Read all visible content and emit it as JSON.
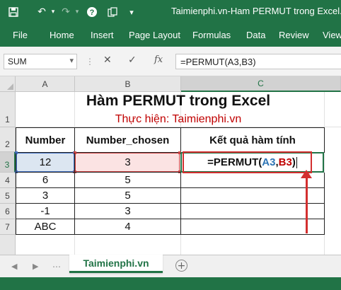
{
  "title_bar": {
    "title": "Taimienphi.vn-Ham PERMUT trong Excel.xls",
    "icons": [
      "save-icon",
      "undo-icon",
      "undo-dropdown-icon",
      "redo-icon",
      "redo-dropdown-icon",
      "help-icon",
      "copy-icon",
      "customize-dropdown-icon"
    ]
  },
  "ribbon_tabs": [
    "File",
    "Home",
    "Insert",
    "Page Layout",
    "Formulas",
    "Data",
    "Review",
    "View"
  ],
  "formula_bar": {
    "name_box": "SUM",
    "cancel_icon": "✕",
    "enter_icon": "✓",
    "fx_label": "fx",
    "formula": "=PERMUT(A3,B3)"
  },
  "grid": {
    "columns": [
      "A",
      "B",
      "C"
    ],
    "rows": [
      "1",
      "2",
      "3",
      "4",
      "5",
      "6",
      "7"
    ],
    "selected_column": "C",
    "selected_row": "3"
  },
  "sheet": {
    "title": "Hàm PERMUT trong Excel",
    "subtitle": "Thực hiện: Taimienphi.vn",
    "headers": [
      "Number",
      "Number_chosen",
      "Kết quả hàm tính"
    ],
    "data_rows": [
      {
        "number": "12",
        "chosen": "3"
      },
      {
        "number": "6",
        "chosen": "5"
      },
      {
        "number": "3",
        "chosen": "5"
      },
      {
        "number": "-1",
        "chosen": "3"
      },
      {
        "number": "ABC",
        "chosen": "4"
      }
    ],
    "active_formula": {
      "prefix": "=PERMUT(",
      "ref_a": "A3",
      "sep": ",",
      "ref_b": "B3",
      "suffix": ")"
    }
  },
  "colors": {
    "excel_green": "#217346",
    "annotation_red": "#d32f2f",
    "ref_a_color": "#2e75b6",
    "ref_b_color": "#c00000"
  },
  "sheet_tabs": {
    "active": "Taimienphi.vn",
    "add_icon": "⊕"
  }
}
